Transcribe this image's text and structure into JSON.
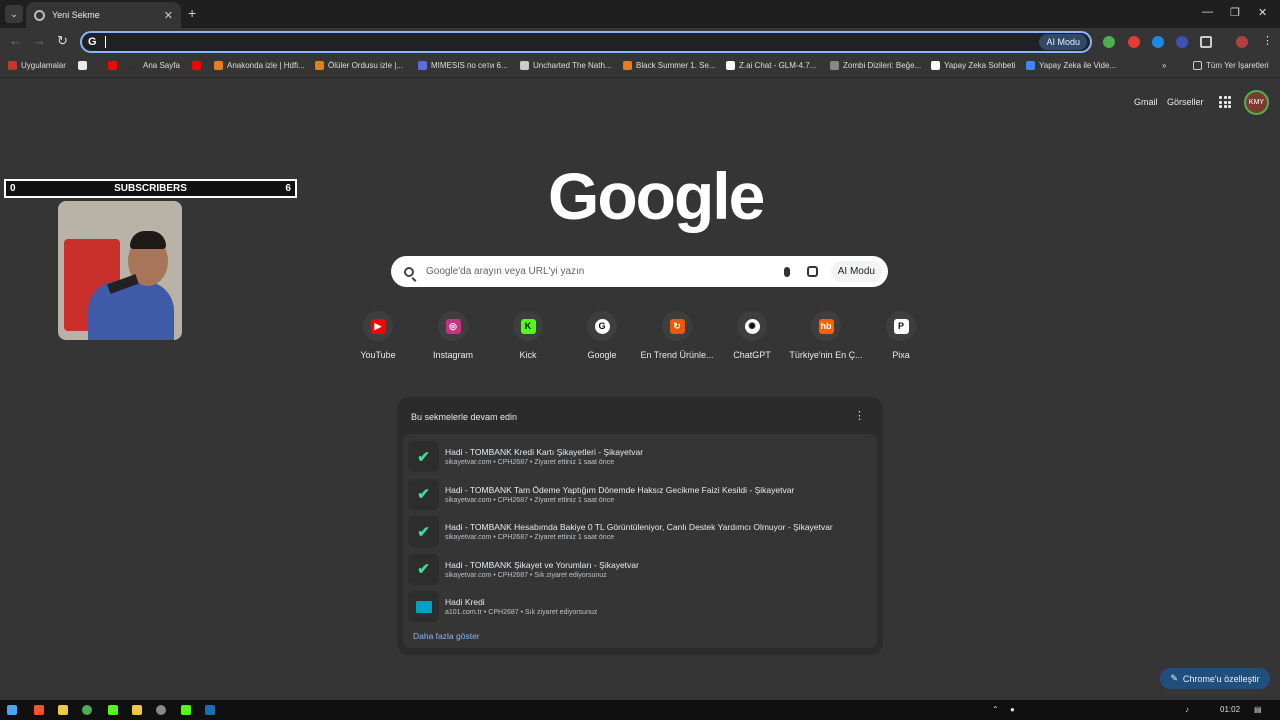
{
  "browser": {
    "tab_title": "Yeni Sekme",
    "tab_close": "✕",
    "new_tab": "+",
    "ai_mode_button": "AI Modu",
    "omnibox_value": ""
  },
  "bookmarks": [
    {
      "label": "Uygulamalar",
      "color": "#c0392b"
    },
    {
      "label": "",
      "color": "#e8eaed"
    },
    {
      "label": "",
      "color": "#ff0000"
    },
    {
      "label": "Ana Sayfa",
      "color": "#333333"
    },
    {
      "label": "",
      "color": "#ff0000"
    },
    {
      "label": "Anakonda izle | Hdfi...",
      "color": "#e67e22"
    },
    {
      "label": "Ölüler Ordusu izle |...",
      "color": "#e67e22"
    },
    {
      "label": "MIMESIS по сети 6...",
      "color": "#5b6ee1"
    },
    {
      "label": "Uncharted The Nath...",
      "color": "#cccccc"
    },
    {
      "label": "Black Summer 1. Se...",
      "color": "#e67e22"
    },
    {
      "label": "Z.ai Chat - GLM-4.7...",
      "color": "#ffffff"
    },
    {
      "label": "Zombi Dizileri: Beğe...",
      "color": "#888888"
    },
    {
      "label": "Yapay Zeka Sohbeti",
      "color": "#ffffff"
    },
    {
      "label": "Yapay Zeka ile Vide...",
      "color": "#4285f4"
    }
  ],
  "all_bookmarks": "Tüm Yer İşaretleri",
  "header": {
    "gmail": "Gmail",
    "images": "Görseller"
  },
  "overlay": {
    "left_count": "0",
    "label": "SUBSCRIBERS",
    "right_count": "6"
  },
  "logo": "Google",
  "search": {
    "placeholder": "Google'da arayın veya URL'yi yazın",
    "ai_mode": "AI Modu"
  },
  "shortcuts": [
    {
      "label": "YouTube",
      "icon": "youtube-icon",
      "color": "#ff0000",
      "glyph": "▶"
    },
    {
      "label": "Instagram",
      "icon": "instagram-icon",
      "color": "#c13584",
      "glyph": "◎"
    },
    {
      "label": "Kick",
      "icon": "kick-icon",
      "color": "#53fc18",
      "glyph": "K"
    },
    {
      "label": "Google",
      "icon": "google-icon",
      "color": "#ffffff",
      "glyph": "G"
    },
    {
      "label": "En Trend Ürünle...",
      "icon": "trend-icon",
      "color": "#e8590c",
      "glyph": "↻"
    },
    {
      "label": "ChatGPT",
      "icon": "chatgpt-icon",
      "color": "#ffffff",
      "glyph": "✺"
    },
    {
      "label": "Türkiye'nin En Ç...",
      "icon": "hepsiburada-icon",
      "color": "#ff6000",
      "glyph": "hb"
    },
    {
      "label": "Pixa",
      "icon": "pixa-icon",
      "color": "#ffffff",
      "glyph": "P"
    }
  ],
  "continue": {
    "title": "Bu sekmelerle devam edin",
    "menu": "⋮",
    "items": [
      {
        "title": "Hadi - TOMBANK Kredi Kartı Şikayetleri - Şikayetvar",
        "sub": "sikayetvar.com • CPH2687 • Ziyaret ettiniz 1 saat önce",
        "icon": "sikayetvar-icon"
      },
      {
        "title": "Hadi - TOMBANK Tam Ödeme Yaptığım Dönemde Haksız Gecikme Faizi Kesildi - Şikayetvar",
        "sub": "sikayetvar.com • CPH2687 • Ziyaret ettiniz 1 saat önce",
        "icon": "sikayetvar-icon"
      },
      {
        "title": "Hadi - TOMBANK Hesabımda Bakiye 0 TL Görüntüleniyor, Canlı Destek Yardımcı Olmuyor - Şikayetvar",
        "sub": "sikayetvar.com • CPH2687 • Ziyaret ettiniz 1 saat önce",
        "icon": "sikayetvar-icon"
      },
      {
        "title": "Hadi - TOMBANK Şikayet ve Yorumları - Şikayetvar",
        "sub": "sikayetvar.com • CPH2687 • Sık ziyaret ediyorsunuz",
        "icon": "sikayetvar-icon"
      },
      {
        "title": "Hadi Kredi",
        "sub": "a101.com.tr • CPH2687 • Sık ziyaret ediyorsunuz",
        "icon": "a101-icon"
      }
    ],
    "more": "Daha fazla göster"
  },
  "customize": "Chrome'u özelleştir",
  "taskbar": {
    "time": "01:02"
  }
}
